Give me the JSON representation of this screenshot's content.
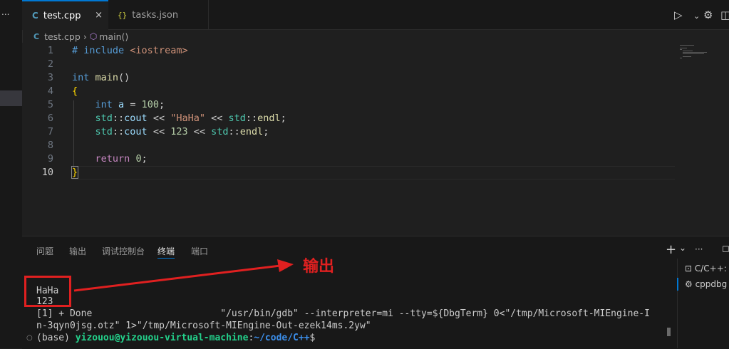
{
  "activity": {
    "more": "..."
  },
  "tabs": [
    {
      "label": "test.cpp",
      "icon": "C",
      "close": "×",
      "active": true
    },
    {
      "label": "tasks.json",
      "icon": "{}",
      "active": false
    }
  ],
  "toolbar": {
    "run_icon": "▷",
    "settings_icon": "⚙",
    "split_icon": "◫"
  },
  "breadcrumb": {
    "file": "test.cpp",
    "symbol": "main()"
  },
  "editor": {
    "line_numbers": [
      "1",
      "2",
      "3",
      "4",
      "5",
      "6",
      "7",
      "8",
      "9",
      "10"
    ],
    "current_line": "10"
  },
  "panel": {
    "tabs": [
      "问题",
      "输出",
      "调试控制台",
      "终端",
      "端口"
    ],
    "active_tab": "终端",
    "actions": {
      "add": "+",
      "chevron": "⌄",
      "more": "···",
      "maximize": "◻"
    }
  },
  "terminal": {
    "lines": [
      "HaHa",
      "123",
      "[1] + Done                       \"/usr/bin/gdb\" --interpreter=mi --tty=${DbgTerm} 0<\"/tmp/Microsoft-MIEngine-I",
      "n-3qyn0jsg.otz\" 1>\"/tmp/Microsoft-MIEngine-Out-ezek14ms.2yw\""
    ],
    "prompt": {
      "env": "(base) ",
      "user_host": "yizouou@yizouou-virtual-machine",
      "sep": ":",
      "path": "~/code/C++",
      "suffix": "$"
    }
  },
  "terminal_list": [
    {
      "label": "C/C++:",
      "icon": "terminal-icon"
    },
    {
      "label": "cppdbg",
      "icon": "debug-icon"
    }
  ],
  "annotation": {
    "label": "输出",
    "color": "#e02020"
  },
  "colors": {
    "accent": "#0078d4",
    "background": "#1f1f1f",
    "panel": "#181818"
  }
}
